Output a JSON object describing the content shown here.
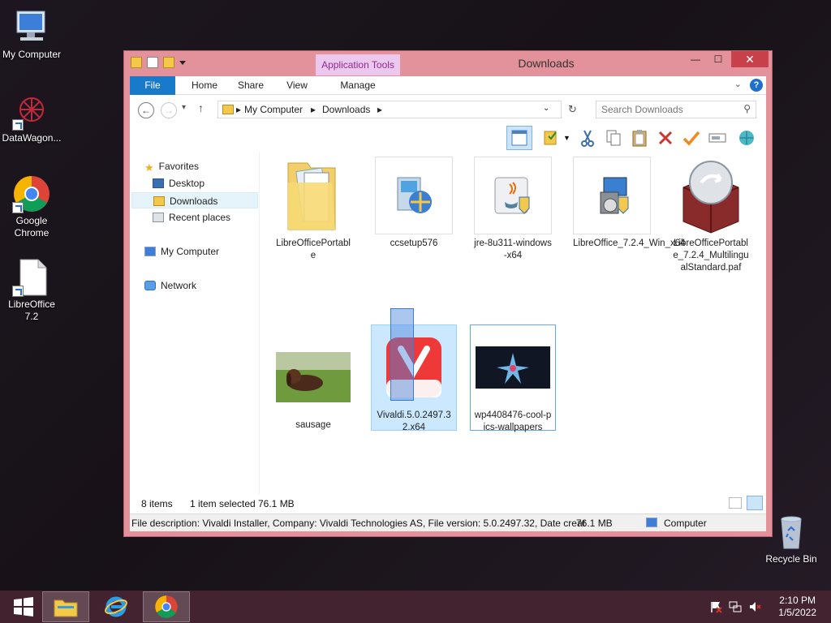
{
  "desktop": {
    "icons": [
      {
        "label": "My Computer"
      },
      {
        "label": "DataWagon..."
      },
      {
        "label": "Google Chrome"
      },
      {
        "label": "LibreOffice 7.2"
      },
      {
        "label": "Recycle Bin"
      }
    ]
  },
  "window": {
    "title": "Downloads",
    "context_tab": "Application Tools",
    "controls": {
      "minimize": "—",
      "maximize": "☐",
      "close": "✕"
    },
    "ribbon_tabs": [
      "File",
      "Home",
      "Share",
      "View",
      "Manage"
    ],
    "help": "?",
    "address": {
      "crumbs": [
        "My Computer",
        "Downloads"
      ],
      "search_placeholder": "Search Downloads"
    },
    "nav": {
      "favorites": "Favorites",
      "desktop": "Desktop",
      "downloads": "Downloads",
      "recent": "Recent places",
      "computer": "My Computer",
      "network": "Network"
    },
    "files": [
      {
        "name": "LibreOfficePortable"
      },
      {
        "name": "ccsetup576"
      },
      {
        "name": "jre-8u311-windows-x64"
      },
      {
        "name": "LibreOffice_7.2.4_Win_x64"
      },
      {
        "name": "LibreOfficePortable_7.2.4_MultilingualStandard.paf"
      },
      {
        "name": "sausage"
      },
      {
        "name": "Vivaldi.5.0.2497.32.x64"
      },
      {
        "name": "wp4408476-cool-pics-wallpapers"
      }
    ],
    "status": {
      "count": "8 items",
      "selection": "1 item selected",
      "size": "76.1 MB"
    },
    "details": {
      "description": "File description: Vivaldi Installer, Company: Vivaldi Technologies AS, File version: 5.0.2497.32, Date creat",
      "size": "76.1 MB",
      "location": "Computer"
    }
  },
  "taskbar": {
    "time": "2:10 PM",
    "date": "1/5/2022"
  }
}
